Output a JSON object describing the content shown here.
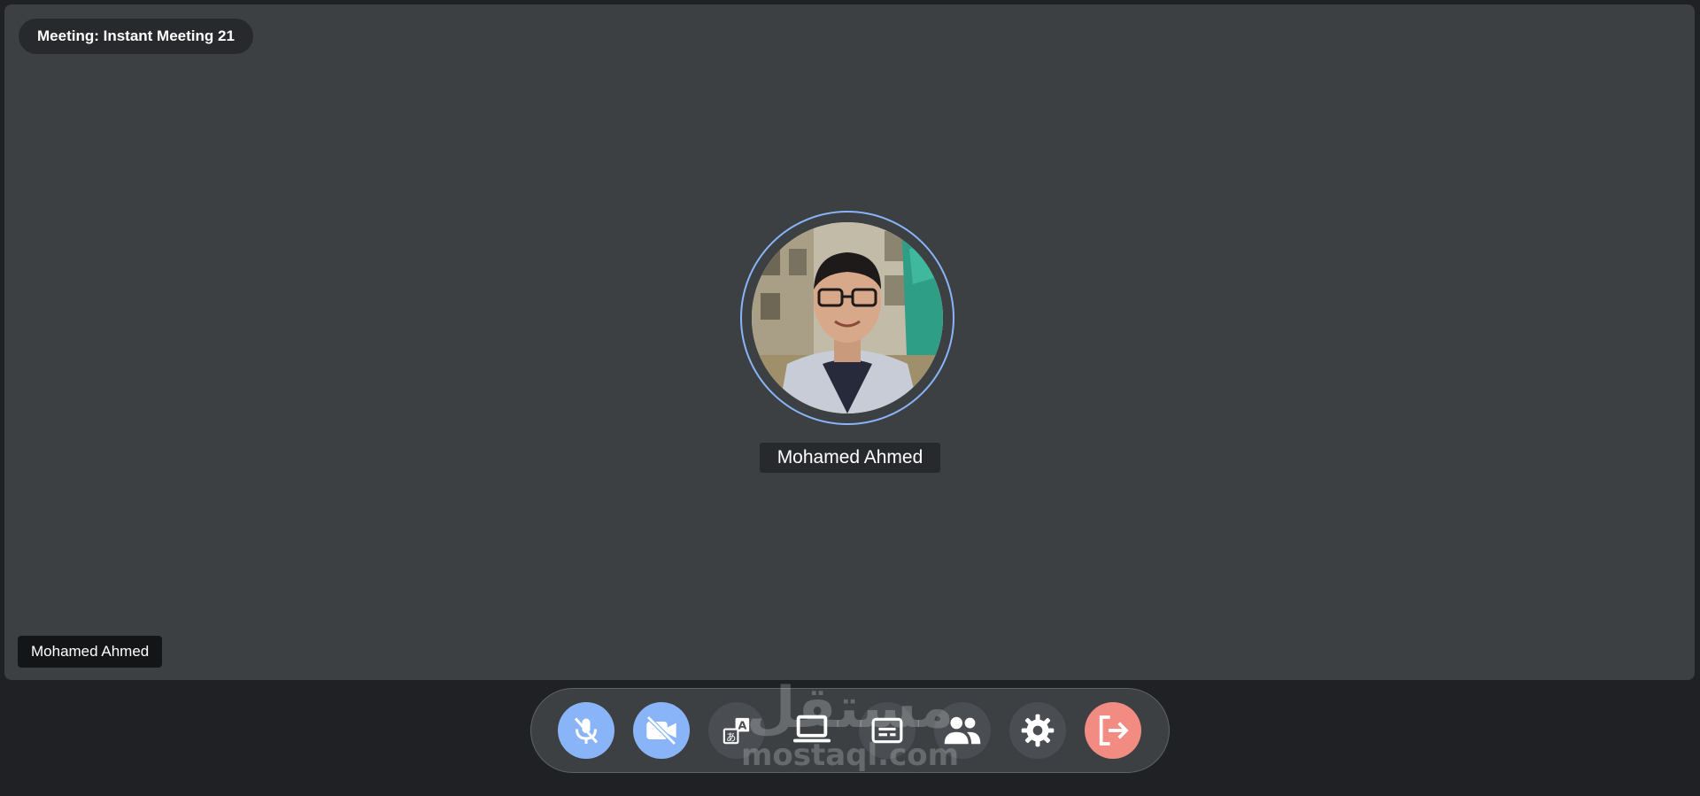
{
  "meeting": {
    "title": "Meeting: Instant Meeting 21"
  },
  "participant": {
    "name": "Mohamed Ahmed",
    "tile_label": "Mohamed Ahmed"
  },
  "toolbar": {
    "buttons": [
      {
        "icon": "mic-off-icon",
        "state": "active"
      },
      {
        "icon": "camera-off-icon",
        "state": "active"
      },
      {
        "icon": "translate-icon",
        "state": "default"
      },
      {
        "icon": "laptop-icon",
        "state": "default"
      },
      {
        "icon": "captions-icon",
        "state": "default"
      },
      {
        "icon": "people-icon",
        "state": "default"
      },
      {
        "icon": "gear-icon",
        "state": "default"
      },
      {
        "icon": "leave-icon",
        "state": "danger"
      }
    ]
  },
  "watermark": {
    "arabic": "مستقل",
    "latin": "mostaql.com"
  },
  "colors": {
    "background": "#202124",
    "stage": "#3c4043",
    "accent_blue": "#8ab4f8",
    "danger_red": "#f28b82"
  }
}
